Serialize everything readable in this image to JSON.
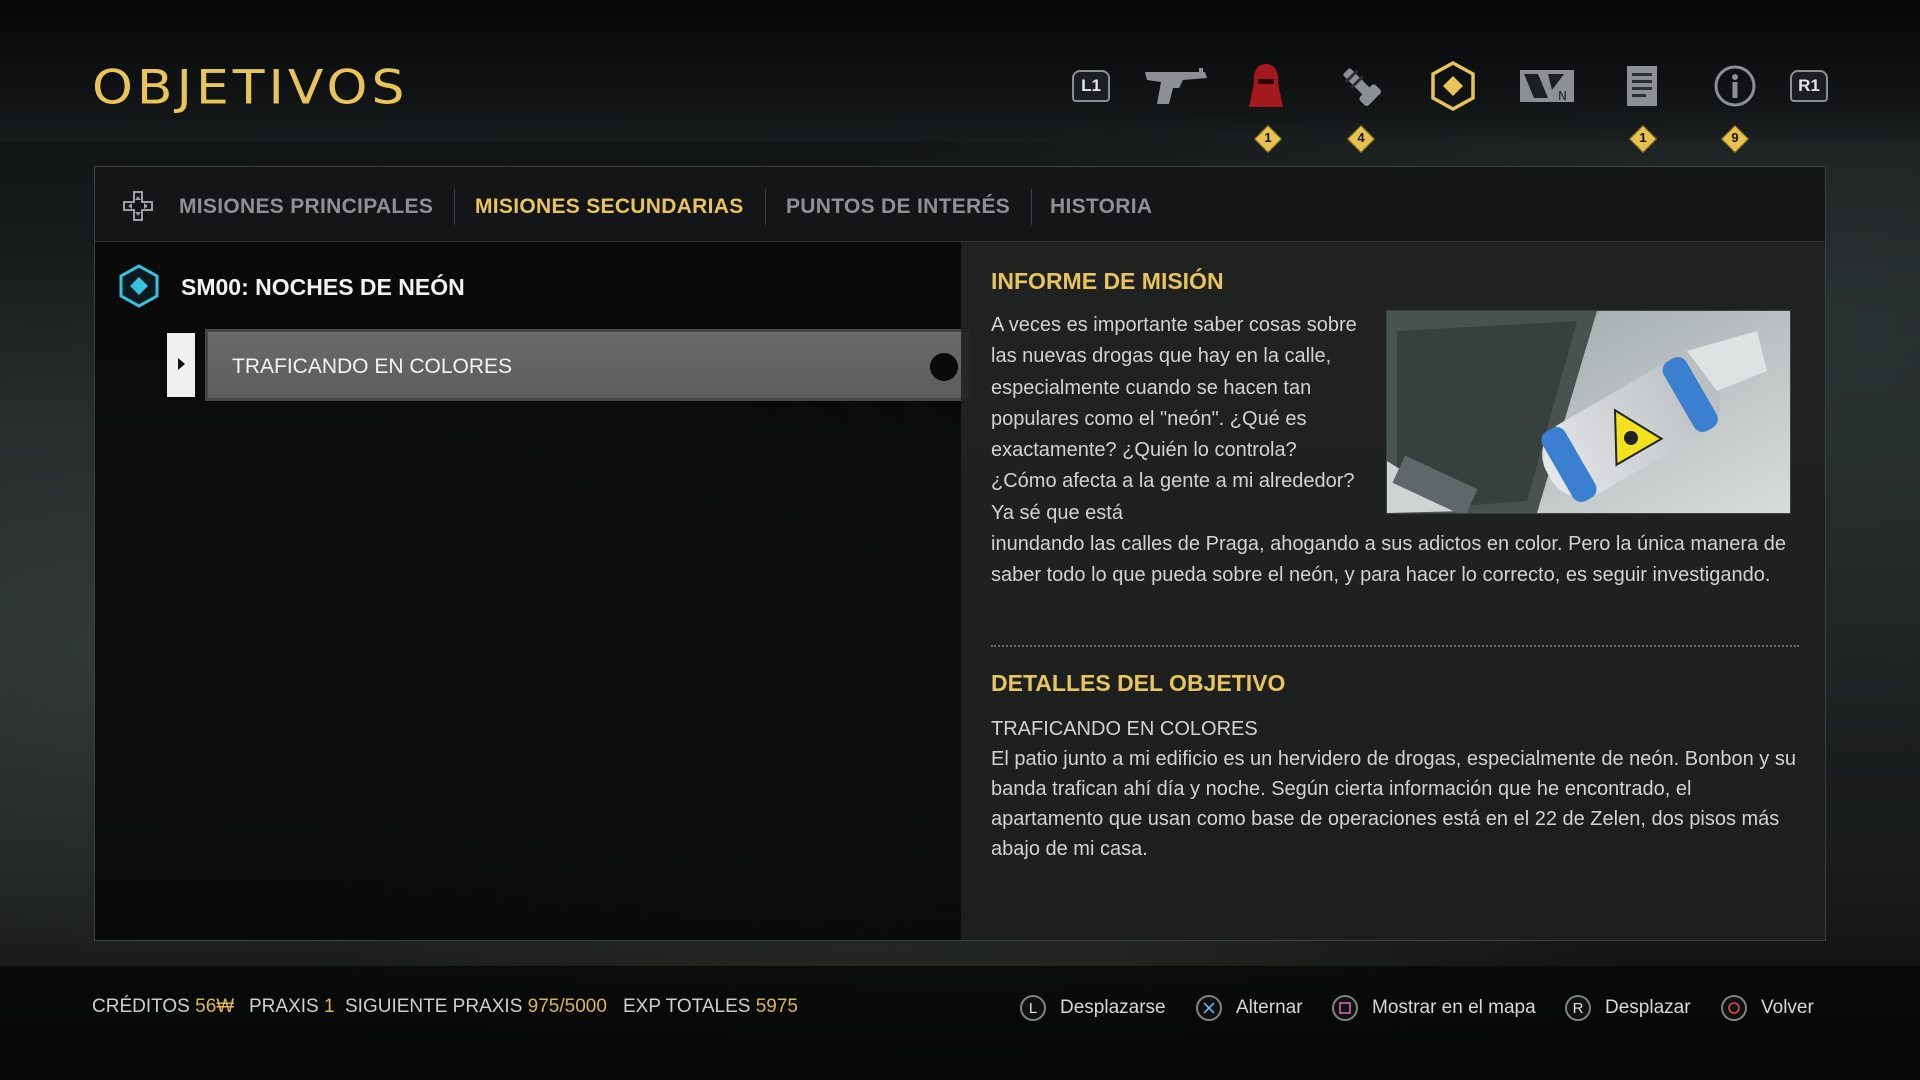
{
  "header": {
    "title": "OBJETIVOS",
    "left_shoulder": "L1",
    "right_shoulder": "R1",
    "menu_icons": [
      "pistol-icon",
      "enemy-hood-icon",
      "tool-icon",
      "objective-diamond-icon",
      "neuropozyne-logo-icon",
      "document-icon",
      "info-icon"
    ],
    "badges": {
      "enemy": "1",
      "tool": "4",
      "document": "1",
      "info": "9"
    }
  },
  "tabs": [
    {
      "label": "MISIONES PRINCIPALES",
      "active": false
    },
    {
      "label": "MISIONES SECUNDARIAS",
      "active": true
    },
    {
      "label": "PUNTOS DE INTERÉS",
      "active": false
    },
    {
      "label": "HISTORIA",
      "active": false
    }
  ],
  "mission": {
    "title": "SM00: NOCHES DE NEÓN",
    "objectives": [
      {
        "label": "TRAFICANDO EN COLORES",
        "selected": true
      }
    ]
  },
  "briefing": {
    "heading": "INFORME DE MISIÓN",
    "text_part1": "A veces es importante saber cosas sobre las nuevas drogas que hay en la calle, especialmente cuando se hacen tan populares como el \"neón\". ¿Qué es exactamente? ¿Quién lo controla? ¿Cómo afecta a la gente a mi alrededor? Ya sé que está",
    "text_part2": "inundando las calles de Praga, ahogando a sus adictos en color. Pero la única manera de saber todo lo que pueda sobre el neón, y para hacer lo correcto, es seguir investigando."
  },
  "objective_details": {
    "heading": "DETALLES DEL OBJETIVO",
    "subtitle": "TRAFICANDO EN COLORES",
    "text": "El patio junto a mi edificio es un hervidero de drogas, especialmente de neón. Bonbon y su banda trafican ahí día y noche. Según cierta información que he encontrado, el apartamento que usan como base de operaciones está en el 22 de Zelen, dos pisos más abajo de mi casa."
  },
  "footer": {
    "credits_label": "CRÉDITOS",
    "credits_value": "56₩",
    "praxis_label": "PRAXIS",
    "praxis_value": "1",
    "next_praxis_label": "SIGUIENTE PRAXIS",
    "next_praxis_value": "975/5000",
    "exp_label": "EXP TOTALES",
    "exp_value": "5975",
    "hints": [
      {
        "button": "L",
        "label": "Desplazarse"
      },
      {
        "button": "cross",
        "label": "Alternar"
      },
      {
        "button": "square",
        "label": "Mostrar en el mapa"
      },
      {
        "button": "R",
        "label": "Desplazar"
      },
      {
        "button": "circle",
        "label": "Volver"
      }
    ]
  },
  "colors": {
    "accent": "#e8c45a",
    "mission_icon": "#35c3e0"
  }
}
